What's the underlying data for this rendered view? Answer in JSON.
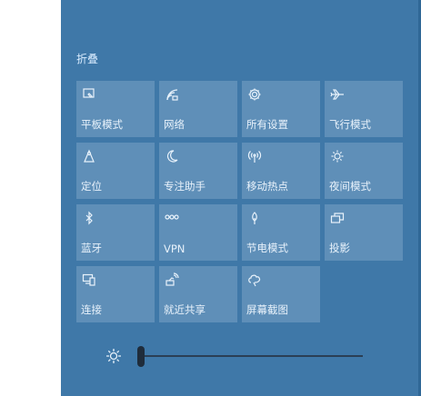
{
  "action_center": {
    "collapse_label": "折叠",
    "tiles": [
      {
        "label": "平板模式",
        "icon": "tablet-mode-icon"
      },
      {
        "label": "网络",
        "icon": "network-icon"
      },
      {
        "label": "所有设置",
        "icon": "gear-icon"
      },
      {
        "label": "飞行模式",
        "icon": "airplane-icon"
      },
      {
        "label": "定位",
        "icon": "location-icon"
      },
      {
        "label": "专注助手",
        "icon": "moon-icon"
      },
      {
        "label": "移动热点",
        "icon": "hotspot-icon"
      },
      {
        "label": "夜间模式",
        "icon": "night-light-icon"
      },
      {
        "label": "蓝牙",
        "icon": "bluetooth-icon"
      },
      {
        "label": "VPN",
        "icon": "vpn-icon"
      },
      {
        "label": "节电模式",
        "icon": "battery-saver-icon"
      },
      {
        "label": "投影",
        "icon": "project-icon"
      },
      {
        "label": "连接",
        "icon": "connect-icon"
      },
      {
        "label": "就近共享",
        "icon": "nearby-share-icon"
      },
      {
        "label": "屏幕截图",
        "icon": "screen-snip-icon"
      }
    ],
    "brightness": {
      "icon": "brightness-icon",
      "level": 0
    },
    "colors": {
      "panel": "#3f78a8",
      "tile": "#5f8fb8",
      "text": "#e8f2fb"
    }
  }
}
